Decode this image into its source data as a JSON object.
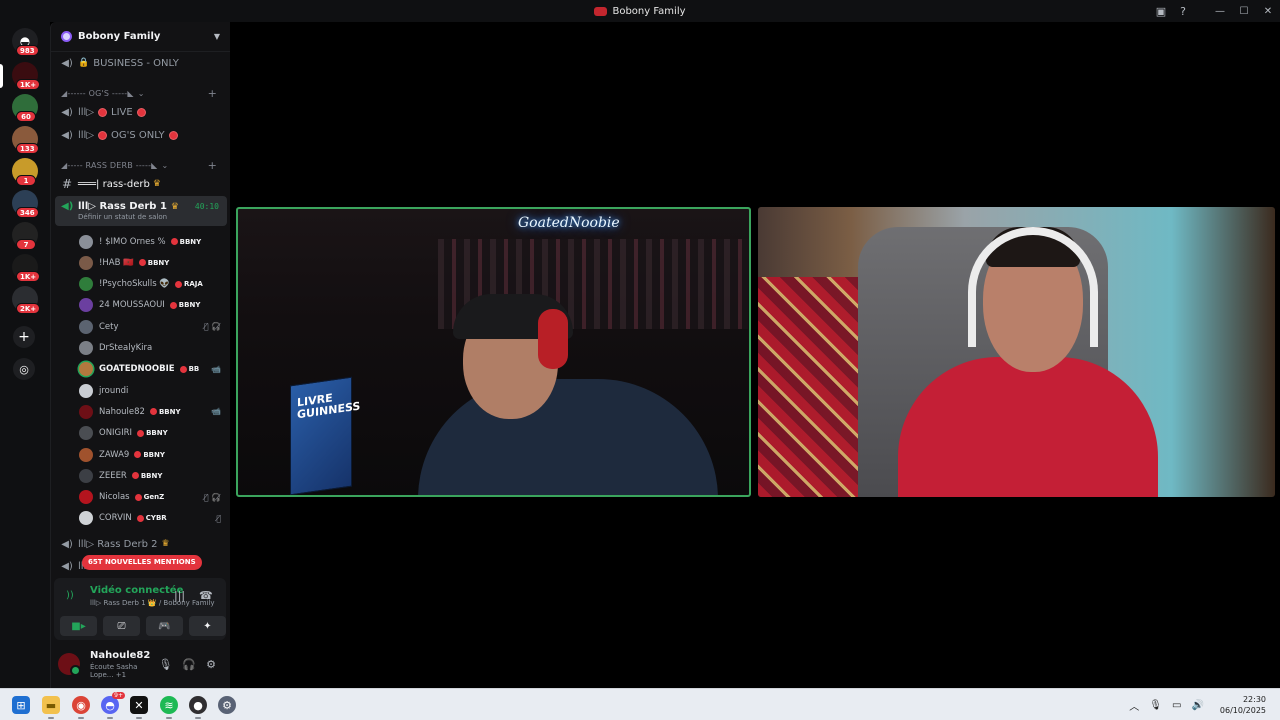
{
  "window": {
    "title": "Bobony Family"
  },
  "colors": {
    "accent_green": "#23a55a",
    "mention_red": "#e3343d",
    "sidebar_bg": "#121214"
  },
  "rail": {
    "badges": [
      "983",
      "1K+",
      "60",
      "133",
      "1",
      "346",
      "7",
      "1K+",
      "2K+"
    ]
  },
  "guild": {
    "name": "Bobony Family"
  },
  "channels": {
    "business": "BUSINESS - ONLY",
    "cat_ogs": "◢------ OG'S -----◣",
    "live": "lll▷",
    "live_label": "LIVE",
    "ogs_only_label": "OG'S ONLY",
    "cat_rass": "◢----- RASS DERB -----◣",
    "rass_text": "═══| rass-derb",
    "rass_derb_1": "lll▷ Rass Derb 1",
    "rass_derb_1_timer": "40:10",
    "rass_derb_1_status": "Définir un statut de salon",
    "rass_derb_2": "lll▷ Rass Derb 2",
    "rass_derb_3": "lll"
  },
  "voice_users": [
    {
      "name": "! $IMO Ornes %",
      "tag": "BBNY",
      "avatar": "#8a8f98",
      "status": ""
    },
    {
      "name": "!HAB 🇲🇦",
      "tag": "BBNY",
      "avatar": "#7a5a48",
      "status": ""
    },
    {
      "name": "!PsychoSkulls 👽",
      "tag": "RAJA",
      "avatar": "#2f7d3b",
      "status": ""
    },
    {
      "name": "24 MOUSSAOUI",
      "tag": "BBNY",
      "avatar": "#6b3fa0",
      "status": ""
    },
    {
      "name": "Cety",
      "tag": "",
      "avatar": "#5b6370",
      "status": "🎙̸ 🎧̸"
    },
    {
      "name": "DrStealyKira",
      "tag": "",
      "avatar": "#7b7f86",
      "status": ""
    },
    {
      "name": "GOATEDNOOBIE",
      "tag": "BB",
      "avatar": "#b2783e",
      "status": "📹",
      "speaking": true
    },
    {
      "name": "jroundi",
      "tag": "",
      "avatar": "#c9cdd3",
      "status": ""
    },
    {
      "name": "Nahoule82",
      "tag": "BBNY",
      "avatar": "#6d0f16",
      "status": "📹"
    },
    {
      "name": "ONIGIRI",
      "tag": "BBNY",
      "avatar": "#4a4d52",
      "status": ""
    },
    {
      "name": "ZAWA9",
      "tag": "BBNY",
      "avatar": "#a0522d",
      "status": ""
    },
    {
      "name": "ZEEER",
      "tag": "BBNY",
      "avatar": "#3c3f45",
      "status": ""
    },
    {
      "name": "Nicolas",
      "tag": "GenZ",
      "avatar": "#b4141e",
      "status": "🎙̸ 🎧̸"
    },
    {
      "name": "CORVIN",
      "tag": "CYBR",
      "avatar": "#cfd2d6",
      "status": "🎙̸"
    }
  ],
  "mentions_pill": "65T NOUVELLES MENTIONS",
  "voice_panel": {
    "title": "Vidéo connectée",
    "sub": "lll▷ Rass Derb 1 👑 / Bobony Family"
  },
  "user_panel": {
    "name": "Nahoule82",
    "activity": "Écoute Sasha Lope... +1"
  },
  "stage": {
    "tile_a_overlay": "GoatedNoobie",
    "tile_a_book": "LIVRE GUINNESS"
  },
  "taskbar": {
    "time": "22:30",
    "date": "06/10/2025",
    "discord_badge": "9+"
  }
}
